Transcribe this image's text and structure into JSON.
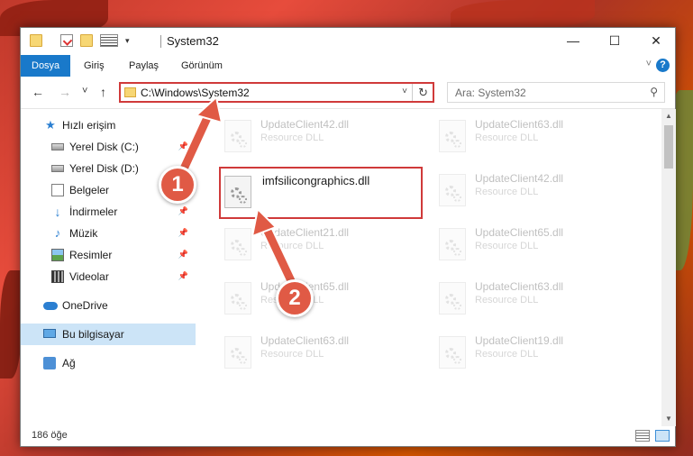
{
  "window": {
    "title": "System32",
    "minimize": "—",
    "maximize": "☐",
    "close": "✕"
  },
  "ribbon": {
    "tabs": [
      {
        "label": "Dosya",
        "active": true
      },
      {
        "label": "Giriş"
      },
      {
        "label": "Paylaş"
      },
      {
        "label": "Görünüm"
      }
    ],
    "help": "?"
  },
  "nav": {
    "back": "←",
    "forward": "→",
    "recent": "˅",
    "up": "↑",
    "address": "C:\\Windows\\System32",
    "address_dropdown": "˅",
    "refresh": "↻",
    "search_placeholder": "Ara: System32",
    "search_icon": "⚲"
  },
  "sidebar": {
    "items": [
      {
        "label": "Hızlı erişim",
        "icon": "star-icon"
      },
      {
        "label": "Yerel Disk (C:)",
        "icon": "drive-icon"
      },
      {
        "label": "Yerel Disk (D:)",
        "icon": "drive-icon"
      },
      {
        "label": "Belgeler",
        "icon": "documents-icon"
      },
      {
        "label": "İndirmeler",
        "icon": "download-icon"
      },
      {
        "label": "Müzik",
        "icon": "music-icon"
      },
      {
        "label": "Resimler",
        "icon": "pictures-icon"
      },
      {
        "label": "Videolar",
        "icon": "videos-icon"
      },
      {
        "label": "OneDrive",
        "icon": "cloud-icon"
      },
      {
        "label": "Bu bilgisayar",
        "icon": "pc-icon",
        "selected": true
      },
      {
        "label": "Ağ",
        "icon": "network-icon"
      }
    ],
    "pin": "📌"
  },
  "files": [
    {
      "name": "UpdateClient42.dll",
      "type": "Resource DLL"
    },
    {
      "name": "UpdateClient63.dll",
      "type": "Resource DLL"
    },
    {
      "name": "imfsilicongraphics.dll",
      "type": ""
    },
    {
      "name": "UpdateClient42.dll",
      "type": "Resource DLL"
    },
    {
      "name": "UpdateClient21.dll",
      "type": "Resource DLL"
    },
    {
      "name": "UpdateClient65.dll",
      "type": "Resource DLL"
    },
    {
      "name": "UpdateClient65.dll",
      "type": "Resource DLL"
    },
    {
      "name": "UpdateClient63.dll",
      "type": "Resource DLL"
    },
    {
      "name": "UpdateClient63.dll",
      "type": "Resource DLL"
    },
    {
      "name": "UpdateClient19.dll",
      "type": "Resource DLL"
    }
  ],
  "status": {
    "count": "186 öğe"
  },
  "annotations": {
    "step1": "1",
    "step2": "2",
    "accent": "#e05a45"
  }
}
